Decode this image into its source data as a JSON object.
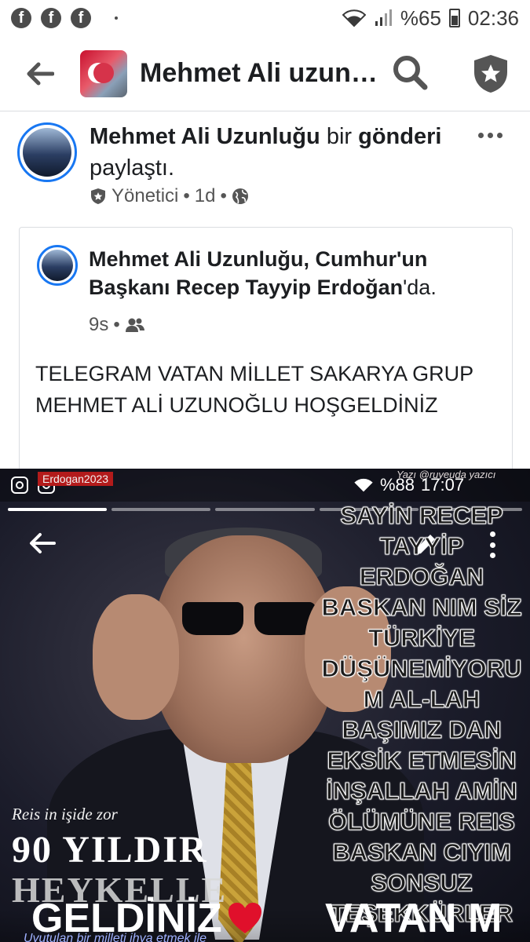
{
  "status_bar": {
    "app_icons": [
      "f",
      "f",
      "f"
    ],
    "battery_percent": "%65",
    "time": "02:36"
  },
  "header": {
    "title": "Mehmet Ali uzun…"
  },
  "post": {
    "author": "Mehmet Ali Uzunluğu",
    "action_pre": "bir",
    "action_bold": "gönderi",
    "action_post": "paylaştı.",
    "role": "Yönetici",
    "time": "1d",
    "separator": "•"
  },
  "shared": {
    "author_line": "Mehmet Ali Uzunluğu, Cumhur'un Başkanı Recep Tayyip Erdoğan",
    "suffix": "'da.",
    "time": "9s",
    "separator": "•",
    "text": "TELEGRAM  VATAN MİLLET SAKARYA GRUP MEHMET ALİ UZUNOĞLU HOŞGELDİNİZ"
  },
  "image": {
    "watermark_left": "Erdogan2023",
    "watermark_right": "Yazı @ruyeuda yazıcı",
    "story_status": "%88",
    "story_time": "17:07",
    "overlay_lines": [
      "SAYİN RECEP",
      "TAYYİP",
      "ERDOĞAN",
      "BASKAN NIM SİZ",
      "TÜRKİYE",
      "DÜŞÜNEMİYORU",
      "M AL-LAH",
      "BAŞIMIZ DAN",
      "EKSİK ETMESİN",
      "İNŞALLAH AMİN",
      "ÖLÜMÜNE REIS",
      "BASKAN CIYIM",
      "SONSUZ",
      "TEŞEKKÜRLER"
    ],
    "reis_text": "Reis in işide zor",
    "yil_text": "90 YILDIR",
    "heykel_text": "HEYKELLE",
    "bottom_left": "GELDİNİZ",
    "bottom_right": "VATAN M",
    "caption": "Uyutulan bir milleti ihya etmek ile"
  },
  "colors": {
    "accent": "#1877f2",
    "meta_text": "#555555",
    "heart": "#e0102b"
  }
}
